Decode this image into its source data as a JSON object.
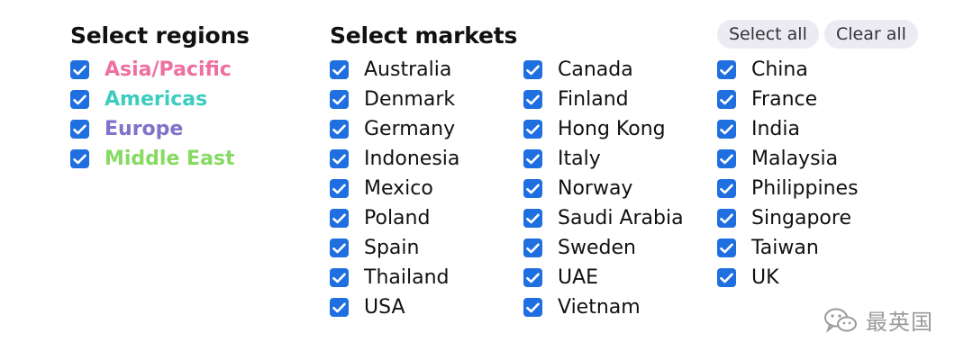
{
  "regions": {
    "title": "Select regions",
    "items": [
      {
        "label": "Asia/Pacific",
        "checked": true,
        "color": "#ef6fa0"
      },
      {
        "label": "Americas",
        "checked": true,
        "color": "#3ccdc0"
      },
      {
        "label": "Europe",
        "checked": true,
        "color": "#7f72c9"
      },
      {
        "label": "Middle East",
        "checked": true,
        "color": "#86da62"
      }
    ]
  },
  "markets": {
    "title": "Select markets",
    "select_all_label": "Select all",
    "clear_all_label": "Clear all",
    "columns": [
      [
        {
          "label": "Australia",
          "checked": true
        },
        {
          "label": "Denmark",
          "checked": true
        },
        {
          "label": "Germany",
          "checked": true
        },
        {
          "label": "Indonesia",
          "checked": true
        },
        {
          "label": "Mexico",
          "checked": true
        },
        {
          "label": "Poland",
          "checked": true
        },
        {
          "label": "Spain",
          "checked": true
        },
        {
          "label": "Thailand",
          "checked": true
        },
        {
          "label": "USA",
          "checked": true
        }
      ],
      [
        {
          "label": "Canada",
          "checked": true
        },
        {
          "label": "Finland",
          "checked": true
        },
        {
          "label": "Hong Kong",
          "checked": true
        },
        {
          "label": "Italy",
          "checked": true
        },
        {
          "label": "Norway",
          "checked": true
        },
        {
          "label": "Saudi Arabia",
          "checked": true
        },
        {
          "label": "Sweden",
          "checked": true
        },
        {
          "label": "UAE",
          "checked": true
        },
        {
          "label": "Vietnam",
          "checked": true
        }
      ],
      [
        {
          "label": "China",
          "checked": true
        },
        {
          "label": "France",
          "checked": true
        },
        {
          "label": "India",
          "checked": true
        },
        {
          "label": "Malaysia",
          "checked": true
        },
        {
          "label": "Philippines",
          "checked": true
        },
        {
          "label": "Singapore",
          "checked": true
        },
        {
          "label": "Taiwan",
          "checked": true
        },
        {
          "label": "UK",
          "checked": true
        }
      ]
    ]
  },
  "watermark": {
    "text": "最英国",
    "icon": "wechat-icon"
  },
  "colors": {
    "checkbox": "#1f6fe0",
    "pill_bg": "#ecebf4"
  }
}
